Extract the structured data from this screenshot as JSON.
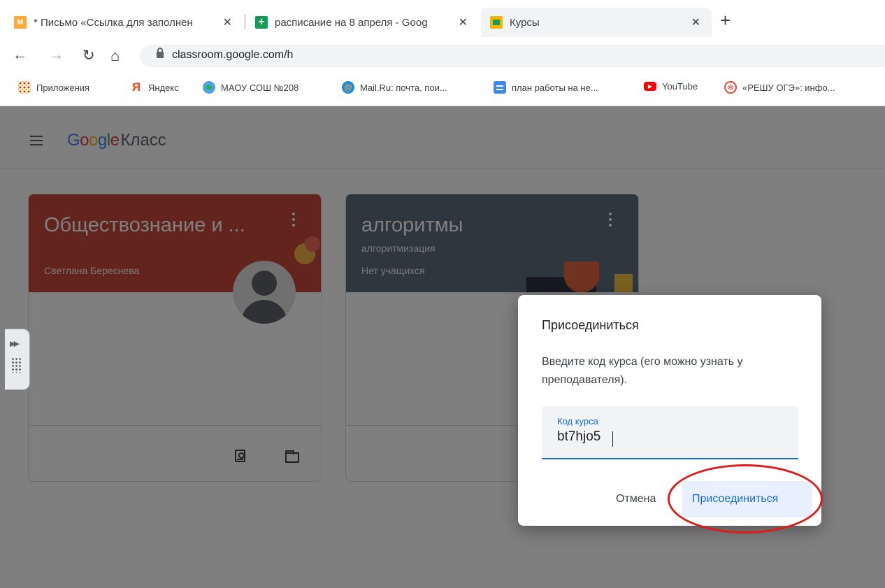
{
  "browser": {
    "tabs": [
      {
        "title": "* Письмо «Ссылка для заполнен",
        "favicon": "M",
        "close": "✕"
      },
      {
        "title": "расписание на 8 апреля - Goog",
        "favicon": "+",
        "close": "✕"
      },
      {
        "title": "Курсы",
        "favicon": "classroom-icon",
        "close": "✕"
      }
    ],
    "new_tab": "+",
    "url": "classroom.google.com/h",
    "bookmarks": [
      {
        "label": "Приложения",
        "icon": "apps-icon"
      },
      {
        "label": "Яндекс",
        "icon": "Я"
      },
      {
        "label": "МАОУ СОШ №208",
        "icon": "globe-icon"
      },
      {
        "label": "Mail.Ru: почта, пои...",
        "icon": "@"
      },
      {
        "label": "план работы на не...",
        "icon": "docs-icon"
      },
      {
        "label": "YouTube",
        "icon": "youtube-icon"
      },
      {
        "label": "«РЕШУ ОГЭ»: инфо...",
        "icon": "reshu-icon"
      }
    ]
  },
  "app": {
    "brand_google": "Google",
    "brand_product": "Класс"
  },
  "cards": [
    {
      "title": "Обществознание и ...",
      "subtitle": "",
      "meta": "Светлана Береснева",
      "color": "#c5493b"
    },
    {
      "title": "алгоритмы",
      "subtitle": "алгоритмизация",
      "meta": "Нет учащихся",
      "color": "#5d6d7c"
    }
  ],
  "dialog": {
    "title": "Присоединиться",
    "description": "Введите код курса (его можно узнать у преподавателя).",
    "field_label": "Код курса",
    "field_value": "bt7hjo5",
    "cancel_label": "Отмена",
    "join_label": "Присоединиться"
  },
  "colors": {
    "accent": "#1967d2",
    "highlight_ring": "#e01b1b"
  }
}
